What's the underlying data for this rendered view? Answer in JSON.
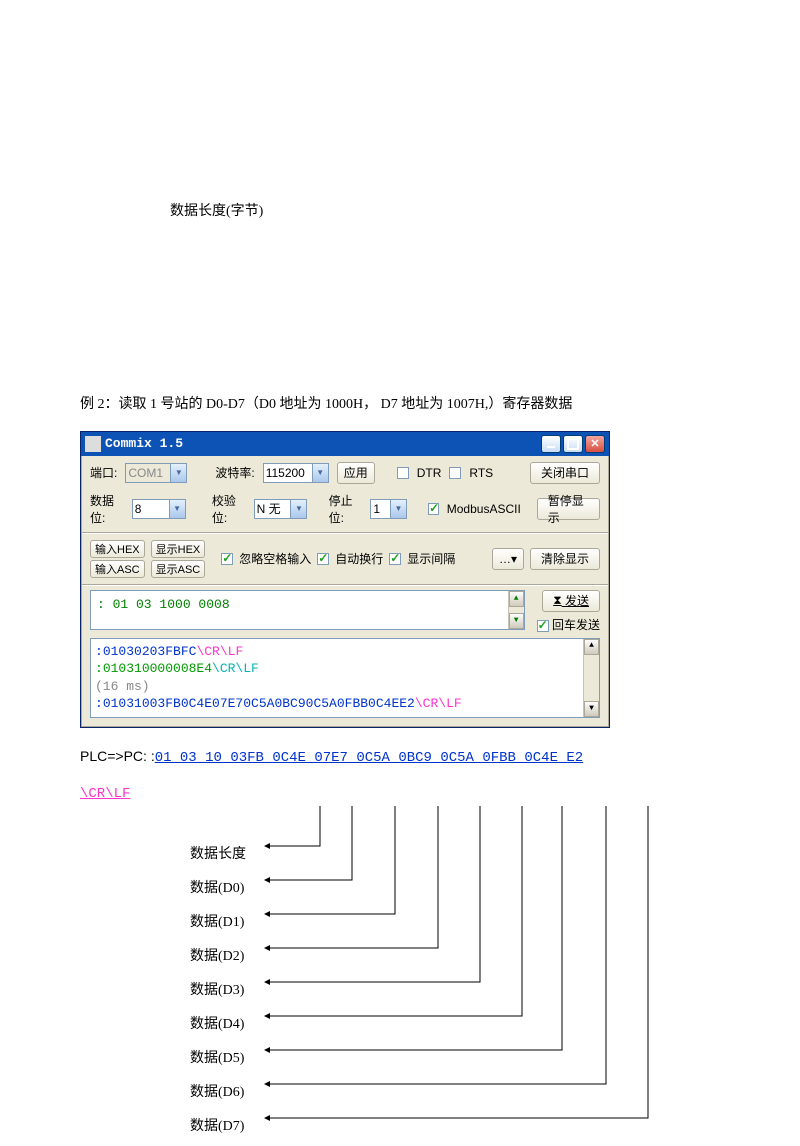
{
  "top_label": "数据长度(字节)",
  "example_text": "例 2：读取 1 号站的 D0-D7（D0 地址为 1000H，  D7 地址为 1007H,）寄存器数据",
  "window": {
    "title": "Commix 1.5",
    "row1": {
      "port_label": "端口:",
      "port_value": "COM1",
      "baud_label": "波特率:",
      "baud_value": "115200",
      "apply": "应用",
      "dtr": "DTR",
      "rts": "RTS",
      "close_port": "关闭串口"
    },
    "row2": {
      "databits_label": "数据位:",
      "databits_value": "8",
      "parity_label": "校验位:",
      "parity_value": "N 无",
      "stopbits_label": "停止位:",
      "stopbits_value": "1",
      "modbus": "ModbusASCII",
      "pause": "暂停显示"
    },
    "toolbar": {
      "in_hex": "输入HEX",
      "in_asc": "输入ASC",
      "show_hex": "显示HEX",
      "show_asc": "显示ASC",
      "ignore_space": "忽略空格输入",
      "auto_wrap": "自动换行",
      "show_gap": "显示间隔",
      "more": "…▾",
      "clear": "清除显示"
    },
    "input_text": ": 01 03 1000 0008",
    "send": "发送",
    "send_icon": "⧗",
    "enter_send": "回车发送",
    "output": {
      "line1_prefix": ":",
      "line1_data": "01030203FBFC",
      "line1_crlf": "\\CR\\LF",
      "line2_prefix": ":",
      "line2_data": "010310000008E4",
      "line2_crlf": "\\CR\\LF",
      "line3": "(16 ms)",
      "line4_prefix": ":",
      "line4_data": "01031003FB0C4E07E70C5A0BC90C5A0FBB0C4EE2",
      "line4_crlf": "\\CR\\LF"
    }
  },
  "plc": {
    "prefix": "PLC=>PC: :",
    "data": "01 03 10 03FB 0C4E 07E7 0C5A 0BC9 0C5A 0FBB 0C4E E2",
    "crlf": "\\CR\\LF"
  },
  "diagram_labels": [
    "数据长度",
    "数据(D0)",
    "数据(D1)",
    "数据(D2)",
    "数据(D3)",
    "数据(D4)",
    "数据(D5)",
    "数据(D6)",
    "数据(D7)"
  ]
}
